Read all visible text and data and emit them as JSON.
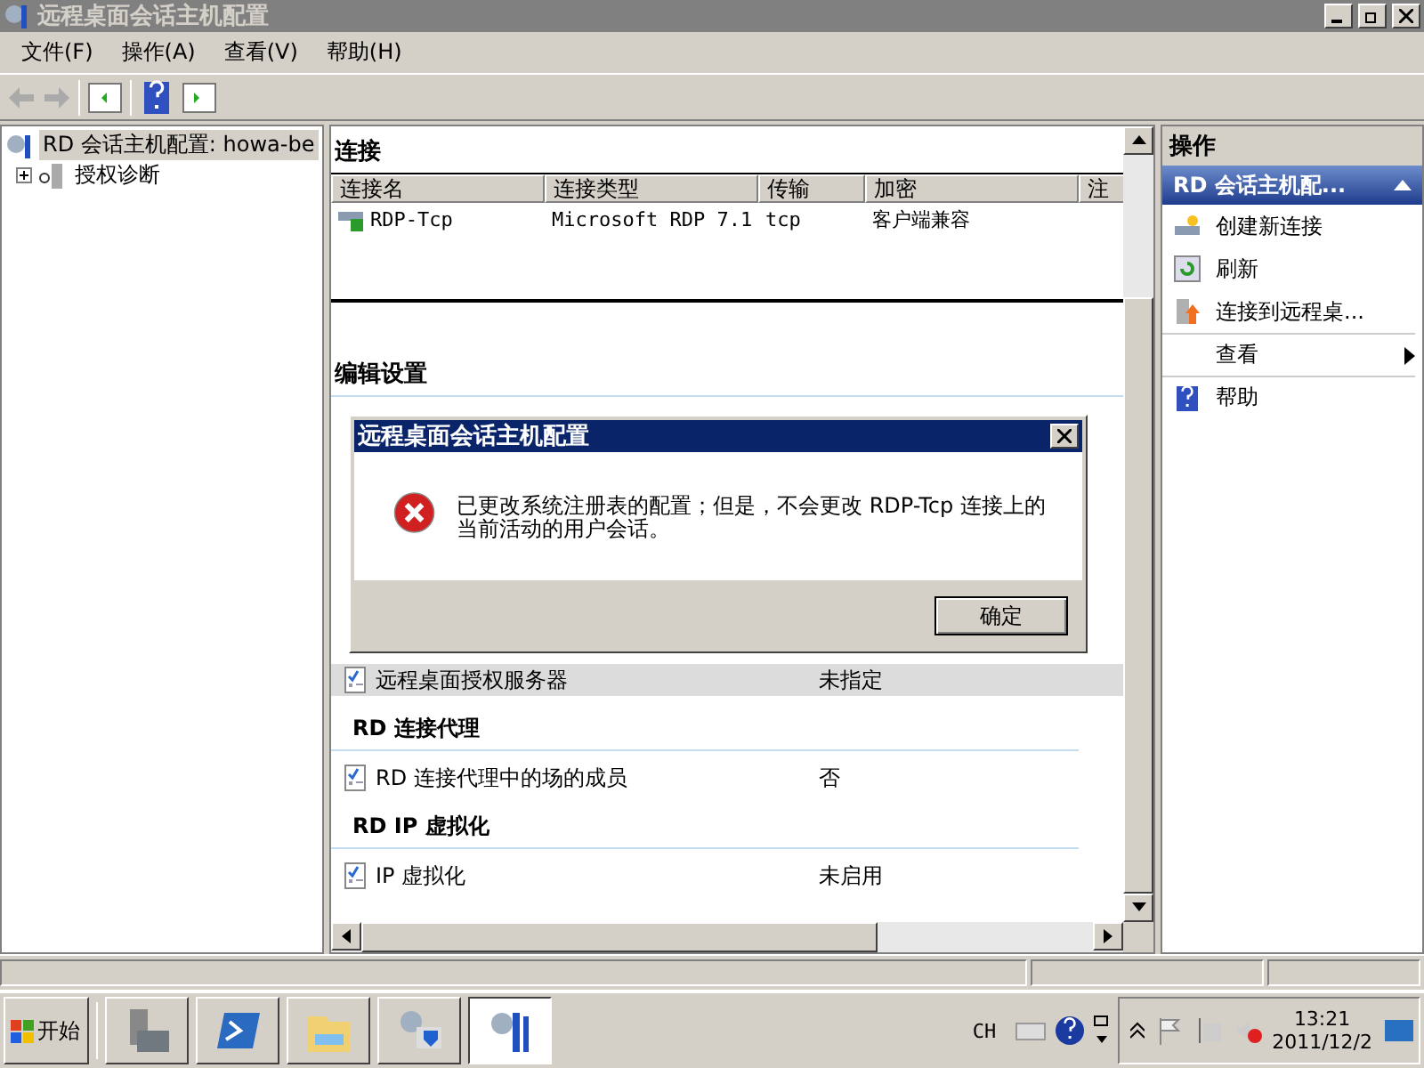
{
  "window": {
    "title": "远程桌面会话主机配置"
  },
  "menu": [
    "文件(F)",
    "操作(A)",
    "查看(V)",
    "帮助(H)"
  ],
  "tree": [
    {
      "label": "RD 会话主机配置: howa-be",
      "selected": true,
      "children": [
        {
          "label": "授权诊断",
          "selected": false,
          "expanded": false
        }
      ]
    }
  ],
  "connections": {
    "title": "连接",
    "columns": [
      "连接名",
      "连接类型",
      "传输",
      "加密",
      "注"
    ],
    "rows": [
      {
        "cells": [
          "RDP-Tcp",
          "Microsoft RDP 7.1",
          "tcp",
          "客户端兼容",
          ""
        ]
      }
    ]
  },
  "settings": {
    "title": "编辑设置",
    "rows": [
      {
        "kind": "setting",
        "label": "远程桌面授权服务器",
        "value": "未指定",
        "selected": true
      },
      {
        "kind": "group",
        "label": "RD 连接代理"
      },
      {
        "kind": "setting",
        "label": "RD 连接代理中的场的成员",
        "value": "否",
        "selected": false
      },
      {
        "kind": "group",
        "label": "RD IP 虚拟化"
      },
      {
        "kind": "setting",
        "label": "IP 虚拟化",
        "value": "未启用",
        "selected": false
      }
    ]
  },
  "actions": {
    "title": "操作",
    "section": "RD 会话主机配...",
    "items": [
      {
        "kind": "new",
        "label": "创建新连接"
      },
      {
        "kind": "refresh",
        "label": "刷新"
      },
      {
        "kind": "connect",
        "label": "连接到远程桌..."
      },
      {
        "kind": "submenu",
        "label": "查看"
      },
      {
        "kind": "help",
        "label": "帮助"
      }
    ]
  },
  "dialog": {
    "title": "远程桌面会话主机配置",
    "message": "已更改系统注册表的配置；但是，不会更改 RDP-Tcp 连接上的当前活动的用户会话。",
    "button": "确定"
  },
  "taskbar": {
    "start": "开始",
    "tasks": [
      {
        "kind": "server",
        "selected": false
      },
      {
        "kind": "shell",
        "selected": false
      },
      {
        "kind": "folder",
        "selected": false
      },
      {
        "kind": "remote",
        "selected": false
      },
      {
        "kind": "config",
        "selected": true
      }
    ],
    "language": "CH",
    "time": "13:21",
    "date": "2011/12/2"
  }
}
